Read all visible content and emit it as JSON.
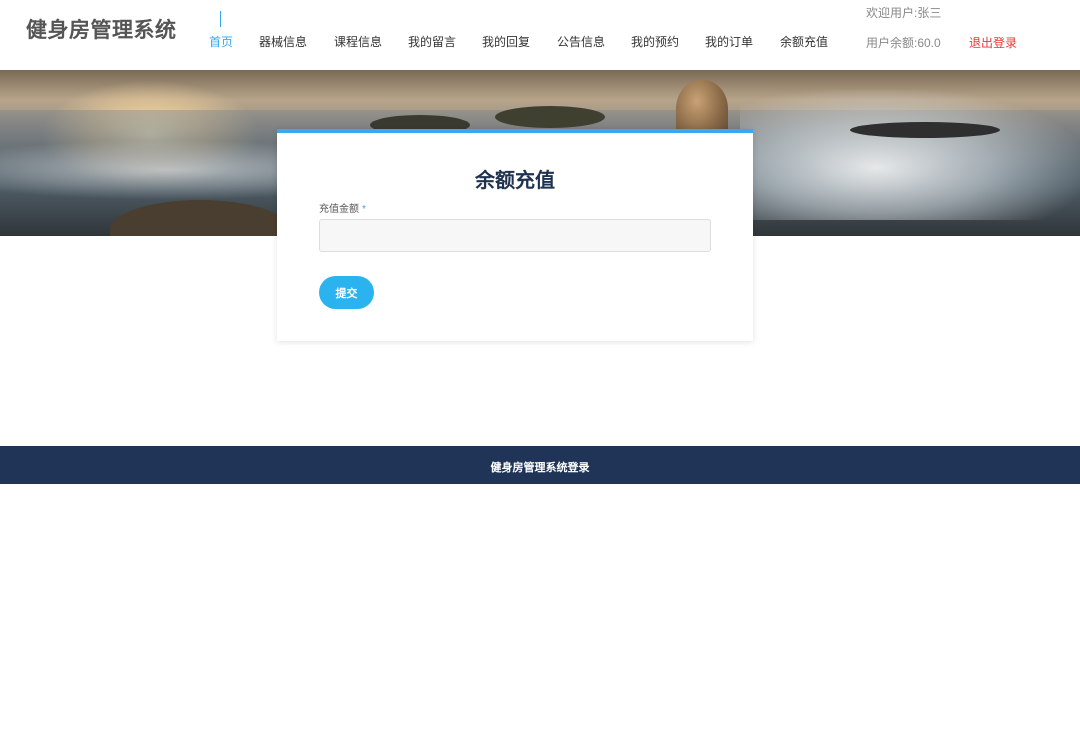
{
  "header": {
    "logo": "健身房管理系统",
    "nav": [
      {
        "label": "首页",
        "active": true
      },
      {
        "label": "器械信息",
        "active": false
      },
      {
        "label": "课程信息",
        "active": false
      },
      {
        "label": "我的留言",
        "active": false
      },
      {
        "label": "我的回复",
        "active": false
      },
      {
        "label": "公告信息",
        "active": false
      },
      {
        "label": "我的预约",
        "active": false
      },
      {
        "label": "我的订单",
        "active": false
      },
      {
        "label": "余额充值",
        "active": false
      }
    ],
    "welcome": "欢迎用户:张三",
    "balance": "用户余额:60.0",
    "logout": "退出登录"
  },
  "form": {
    "title": "余额充值",
    "amount_label": "充值金额",
    "required_mark": "*",
    "amount_value": "",
    "submit_label": "提交"
  },
  "footer": {
    "text": "健身房管理系统登录"
  },
  "colors": {
    "accent": "#3aa8f0",
    "logout": "#e53935",
    "footer_bg": "#1f3456",
    "title": "#1f3250"
  }
}
